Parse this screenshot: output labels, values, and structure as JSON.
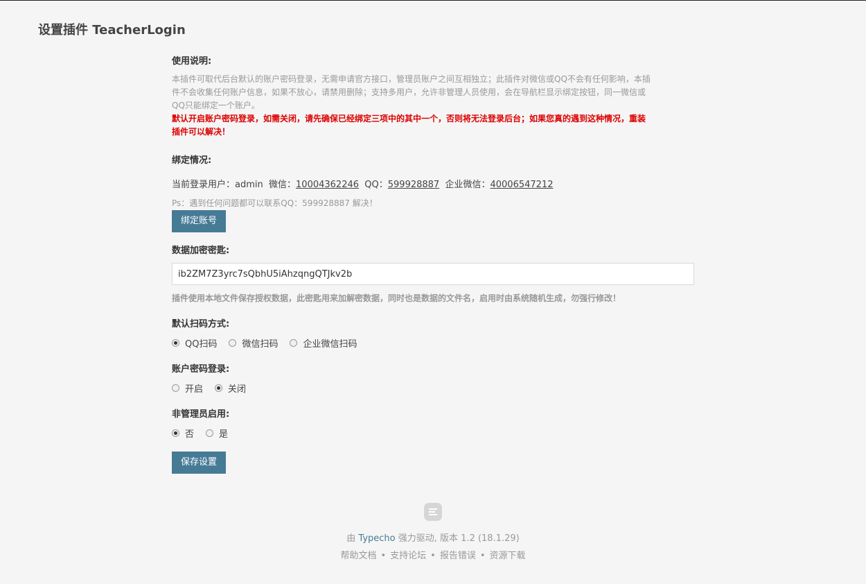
{
  "page": {
    "title": "设置插件 TeacherLogin"
  },
  "usage": {
    "label": "使用说明:",
    "desc_line1": "本插件可取代后台默认的账户密码登录，无需申请官方接口，管理员账户之间互相独立；此插件对微信或QQ不会有任何影响，本插",
    "desc_line2": "件不会收集任何账户信息，如果不放心，请禁用删除；支持多用户，允许非管理人员使用，会在导航栏显示绑定按钮，同一微信或",
    "desc_line3": "QQ只能绑定一个账户。",
    "warn_line1": "默认开启账户密码登录，如需关闭，请先确保已经绑定三项中的其中一个，否则将无法登录后台；如果您真的遇到这种情况，重装",
    "warn_line2": "插件可以解决！"
  },
  "binding": {
    "label": "绑定情况:",
    "user_label": "当前登录用户：",
    "user": "admin",
    "wechat_label": "微信：",
    "wechat": "10004362246",
    "qq_label": "QQ：",
    "qq": "599928887",
    "work_label": "企业微信：",
    "work": "40006547212",
    "ps": "Ps：遇到任何问题都可以联系QQ：599928887 解决！",
    "button": "绑定账号"
  },
  "secret": {
    "label": "数据加密密匙:",
    "value": "ib2ZM7Z3yrc7sQbhU5iAhzqngQTJkv2b",
    "note": "插件使用本地文件保存授权数据，此密匙用来加解密数据，同时也是数据的文件名，启用时由系统随机生成，勿强行修改！"
  },
  "scan": {
    "label": "默认扫码方式:",
    "options": [
      "QQ扫码",
      "微信扫码",
      "企业微信扫码"
    ],
    "selected": "QQ扫码"
  },
  "password_login": {
    "label": "账户密码登录:",
    "options": [
      "开启",
      "关闭"
    ],
    "selected": "关闭"
  },
  "non_admin": {
    "label": "非管理员启用:",
    "options": [
      "否",
      "是"
    ],
    "selected": "否"
  },
  "save_button": "保存设置",
  "footer": {
    "by": "由",
    "brand": "Typecho",
    "rest": "强力驱动, 版本 1.2 (18.1.29)",
    "links": [
      "帮助文档",
      "支持论坛",
      "报告错误",
      "资源下载"
    ],
    "separator": "•"
  }
}
